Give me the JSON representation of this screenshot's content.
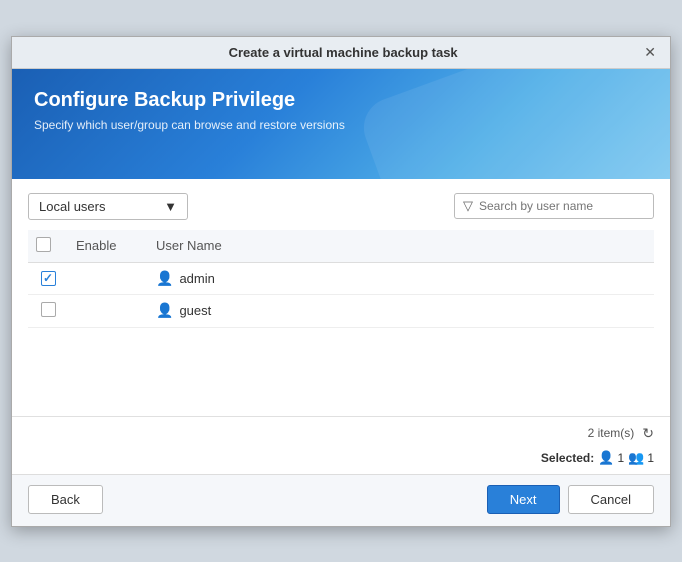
{
  "dialog": {
    "title": "Create a virtual machine backup task",
    "header": {
      "title": "Configure Backup Privilege",
      "subtitle": "Specify which user/group can browse and restore versions"
    },
    "toolbar": {
      "dropdown_label": "Local users",
      "search_placeholder": "Search by user name"
    },
    "table": {
      "columns": [
        "",
        "Enable",
        "User Name"
      ],
      "rows": [
        {
          "id": 1,
          "enabled": true,
          "name": "admin"
        },
        {
          "id": 2,
          "enabled": false,
          "name": "guest"
        }
      ]
    },
    "footer": {
      "items_count": "2 item(s)",
      "selected_label": "Selected:",
      "selected_user_count": "1",
      "selected_group_count": "1"
    },
    "buttons": {
      "back": "Back",
      "next": "Next",
      "cancel": "Cancel"
    }
  }
}
